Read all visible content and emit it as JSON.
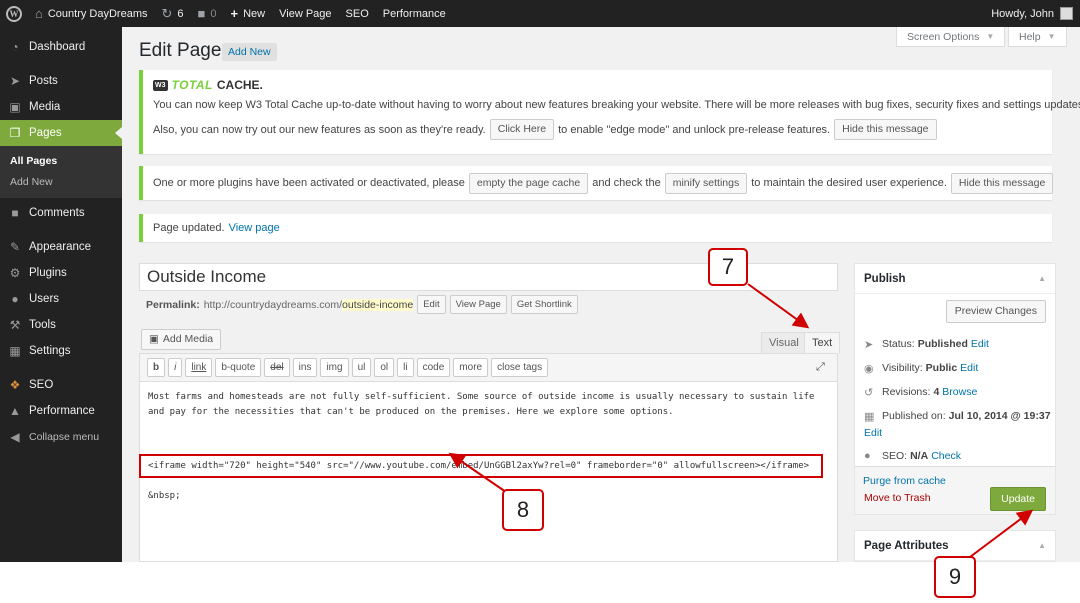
{
  "adminbar": {
    "site_name": "Country DayDreams",
    "updates_count": "6",
    "comments_count": "0",
    "new_label": "New",
    "view_page": "View Page",
    "seo": "SEO",
    "performance": "Performance",
    "howdy": "Howdy, John"
  },
  "sidebar": {
    "dashboard": "Dashboard",
    "posts": "Posts",
    "media": "Media",
    "pages": "Pages",
    "all_pages": "All Pages",
    "add_new": "Add New",
    "comments": "Comments",
    "appearance": "Appearance",
    "plugins": "Plugins",
    "users": "Users",
    "tools": "Tools",
    "settings": "Settings",
    "seo": "SEO",
    "performance": "Performance",
    "collapse": "Collapse menu"
  },
  "header": {
    "title": "Edit Page",
    "add_new": "Add New",
    "screen_options": "Screen Options",
    "help": "Help"
  },
  "notices": {
    "w3_total": "TOTAL",
    "w3_cache": "CACHE.",
    "w3_badge": "W3",
    "w3_line1": "You can now keep W3 Total Cache up-to-date without having to worry about new features breaking your website. There will be more releases with bug fixes, security fixes and settings updates.",
    "w3_line2_a": "Also, you can now try out our new features as soon as they're ready.",
    "click_here": "Click Here",
    "w3_line2_b": "to enable \"edge mode\" and unlock pre-release features.",
    "hide_message": "Hide this message",
    "plugins_a": "One or more plugins have been activated or deactivated, please",
    "empty_cache": "empty the page cache",
    "plugins_b": "and check the",
    "minify": "minify settings",
    "plugins_c": "to maintain the desired user experience.",
    "hide_message_2": "Hide this message",
    "updated": "Page updated.",
    "view_page": "View page"
  },
  "editor": {
    "title": "Outside Income",
    "permalink_label": "Permalink:",
    "permalink_base": "http://countrydaydreams.com/",
    "permalink_slug": "outside-income",
    "edit": "Edit",
    "view_page": "View Page",
    "get_shortlink": "Get Shortlink",
    "add_media": "Add Media",
    "tab_visual": "Visual",
    "tab_text": "Text",
    "quicktags": [
      "b",
      "i",
      "link",
      "b-quote",
      "del",
      "ins",
      "img",
      "ul",
      "ol",
      "li",
      "code",
      "more",
      "close tags"
    ],
    "content_line1": "Most farms and homesteads are not fully self-sufficient.  Some source of outside income is usually necessary to sustain life",
    "content_line2": "and pay for the necessities that can't be produced on the premises.  Here we explore some options.",
    "iframe_code": "<iframe width=\"720\" height=\"540\" src=\"//www.youtube.com/embed/UnGGBl2axYw?rel=0\" frameborder=\"0\" allowfullscreen></iframe>",
    "nbsp": "&nbsp;"
  },
  "publish": {
    "heading": "Publish",
    "preview": "Preview Changes",
    "status_label": "Status:",
    "status_value": "Published",
    "visibility_label": "Visibility:",
    "visibility_value": "Public",
    "revisions_label": "Revisions:",
    "revisions_value": "4",
    "browse": "Browse",
    "published_label": "Published on:",
    "published_value": "Jul 10, 2014 @ 19:37",
    "seo_label": "SEO:",
    "seo_value": "N/A",
    "check": "Check",
    "edit": "Edit",
    "purge": "Purge from cache",
    "trash": "Move to Trash",
    "update": "Update"
  },
  "page_attributes": {
    "heading": "Page Attributes"
  },
  "callouts": {
    "c7": "7",
    "c8": "8",
    "c9": "9"
  },
  "colors": {
    "accent_green": "#7ea93c",
    "adminbar": "#222222",
    "link": "#0073aa",
    "annotation_red": "#d00000"
  }
}
